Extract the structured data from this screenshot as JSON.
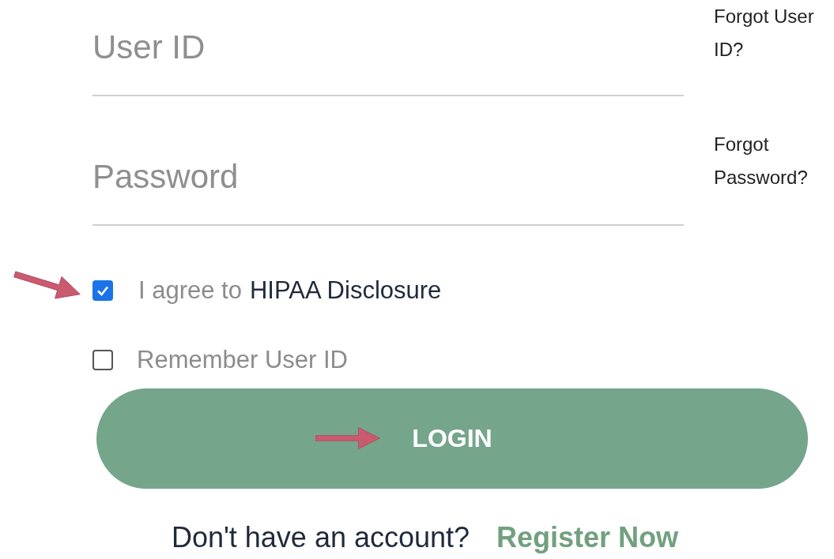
{
  "fields": [
    {
      "placeholder": "User ID",
      "link": "Forgot User ID?"
    },
    {
      "placeholder": "Password",
      "link": "Forgot Password?"
    }
  ],
  "options": [
    {
      "label": "I agree to",
      "link": "HIPAA Disclosure",
      "checked": true
    },
    {
      "label": "Remember User ID",
      "checked": false
    }
  ],
  "login_button": "LOGIN",
  "footer": {
    "text": "Don't have an account?",
    "link": "Register Now"
  }
}
